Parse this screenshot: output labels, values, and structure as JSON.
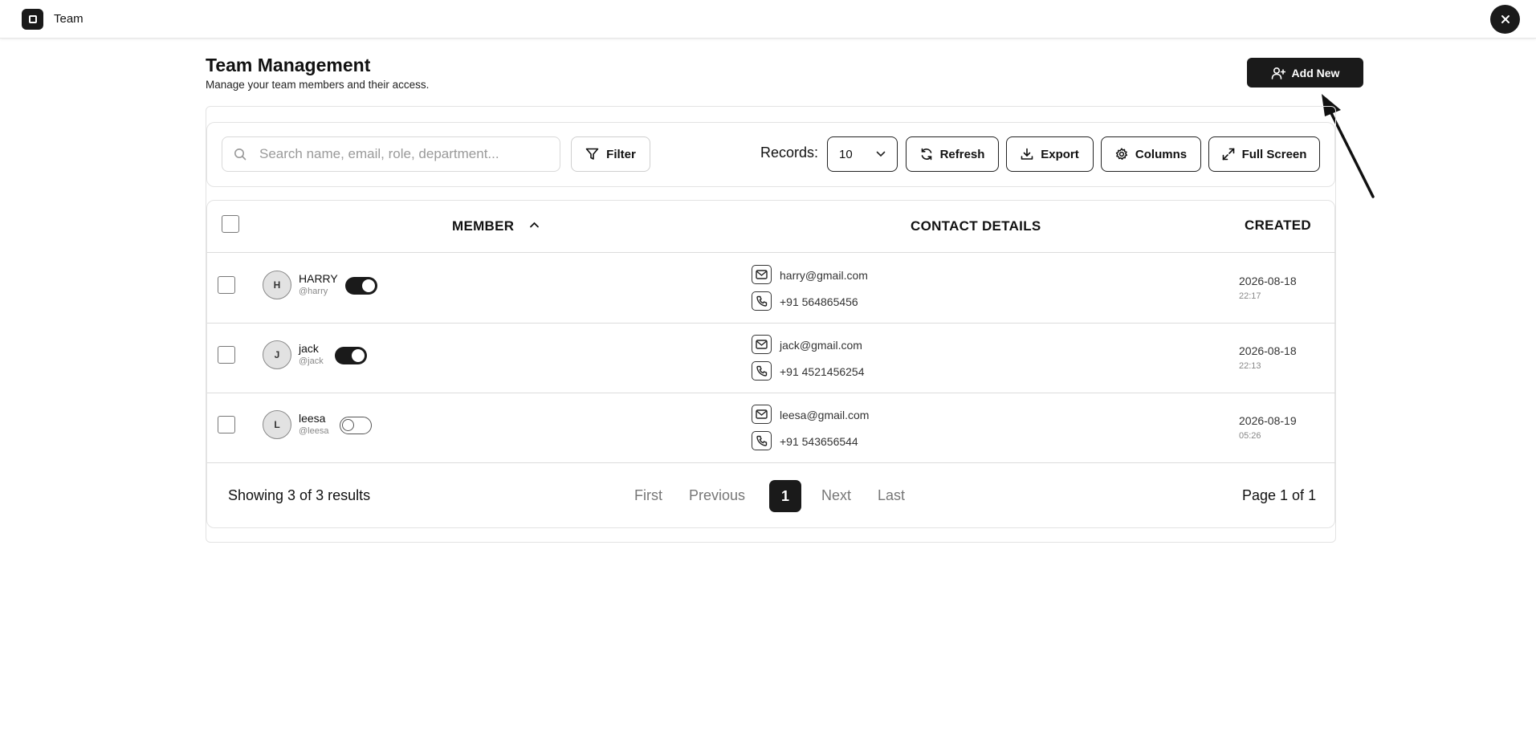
{
  "app": {
    "title": "Team"
  },
  "header": {
    "title": "Team Management",
    "subtitle": "Manage your team members and their access.",
    "add_label": "Add New"
  },
  "toolbar": {
    "search_placeholder": "Search name, email, role, department...",
    "filter_label": "Filter",
    "records_label": "Records:",
    "records_value": "10",
    "refresh_label": "Refresh",
    "export_label": "Export",
    "columns_label": "Columns",
    "fullscreen_label": "Full Screen"
  },
  "table": {
    "columns": [
      "MEMBER",
      "CONTACT DETAILS",
      "CREATED"
    ],
    "sort": {
      "column": "MEMBER",
      "direction": "ascending"
    },
    "rows": [
      {
        "initial": "H",
        "name": "HARRY",
        "username": "@harry",
        "active": true,
        "email": "harry@gmail.com",
        "phone": "+91 564865456",
        "date": "2026-08-18",
        "time": "22:17"
      },
      {
        "initial": "J",
        "name": "jack",
        "username": "@jack",
        "active": true,
        "email": "jack@gmail.com",
        "phone": "+91 4521456254",
        "date": "2026-08-18",
        "time": "22:13"
      },
      {
        "initial": "L",
        "name": "leesa",
        "username": "@leesa",
        "active": false,
        "email": "leesa@gmail.com",
        "phone": "+91 543656544",
        "date": "2026-08-19",
        "time": "05:26"
      }
    ]
  },
  "pagination": {
    "summary": "Showing 3 of 3 results",
    "first": "First",
    "previous": "Previous",
    "current": "1",
    "next": "Next",
    "last": "Last",
    "page_info": "Page 1 of 1"
  },
  "colors": {
    "primary": "#1a1a1a",
    "border": "#e3e3e3",
    "muted": "#888888"
  }
}
